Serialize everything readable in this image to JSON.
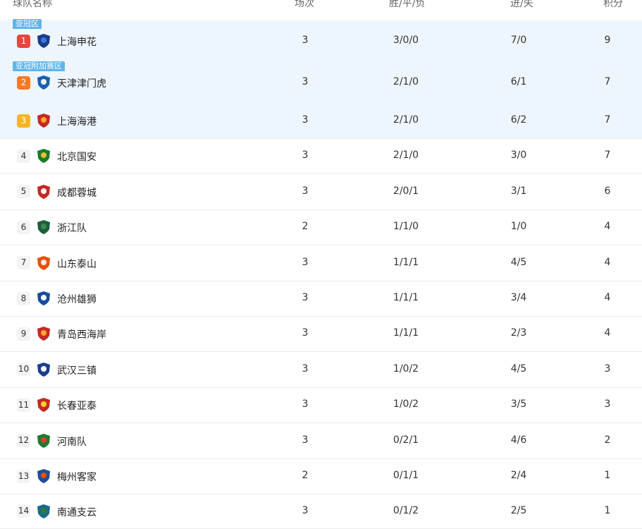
{
  "headers": {
    "team": "球队名称",
    "played": "场次",
    "wdl": "胜/平/负",
    "goals": "进/失",
    "points": "积分"
  },
  "zones": {
    "acl": "亚冠区",
    "acl_playoff": "亚冠附加赛区"
  },
  "rows": [
    {
      "rank": "1",
      "team": "上海申花",
      "played": "3",
      "wdl": "3/0/0",
      "goals": "7/0",
      "points": "9"
    },
    {
      "rank": "2",
      "team": "天津津门虎",
      "played": "3",
      "wdl": "2/1/0",
      "goals": "6/1",
      "points": "7"
    },
    {
      "rank": "3",
      "team": "上海海港",
      "played": "3",
      "wdl": "2/1/0",
      "goals": "6/2",
      "points": "7"
    },
    {
      "rank": "4",
      "team": "北京国安",
      "played": "3",
      "wdl": "2/1/0",
      "goals": "3/0",
      "points": "7"
    },
    {
      "rank": "5",
      "team": "成都蓉城",
      "played": "3",
      "wdl": "2/0/1",
      "goals": "3/1",
      "points": "6"
    },
    {
      "rank": "6",
      "team": "浙江队",
      "played": "2",
      "wdl": "1/1/0",
      "goals": "1/0",
      "points": "4"
    },
    {
      "rank": "7",
      "team": "山东泰山",
      "played": "3",
      "wdl": "1/1/1",
      "goals": "4/5",
      "points": "4"
    },
    {
      "rank": "8",
      "team": "沧州雄狮",
      "played": "3",
      "wdl": "1/1/1",
      "goals": "3/4",
      "points": "4"
    },
    {
      "rank": "9",
      "team": "青岛西海岸",
      "played": "3",
      "wdl": "1/1/1",
      "goals": "2/3",
      "points": "4"
    },
    {
      "rank": "10",
      "team": "武汉三镇",
      "played": "3",
      "wdl": "1/0/2",
      "goals": "4/5",
      "points": "3"
    },
    {
      "rank": "11",
      "team": "长春亚泰",
      "played": "3",
      "wdl": "1/0/2",
      "goals": "3/5",
      "points": "3"
    },
    {
      "rank": "12",
      "team": "河南队",
      "played": "3",
      "wdl": "0/2/1",
      "goals": "4/6",
      "points": "2"
    },
    {
      "rank": "13",
      "team": "梅州客家",
      "played": "2",
      "wdl": "0/1/1",
      "goals": "2/4",
      "points": "1"
    },
    {
      "rank": "14",
      "team": "南通支云",
      "played": "3",
      "wdl": "0/1/2",
      "goals": "2/5",
      "points": "1"
    }
  ],
  "colors": {
    "zone_label": "#5fb5ea",
    "highlight_row": "#eef6fd",
    "rank1": "#e8453c",
    "rank2": "#f57a28",
    "rank3": "#f6b526"
  },
  "logos": [
    "shenhua-crest-icon",
    "jinmenhu-crest-icon",
    "haigang-crest-icon",
    "guoan-crest-icon",
    "rongcheng-crest-icon",
    "zhejiang-crest-icon",
    "taishan-crest-icon",
    "xiongshi-crest-icon",
    "xihaian-crest-icon",
    "sanzhen-crest-icon",
    "yatai-crest-icon",
    "henan-crest-icon",
    "kejia-crest-icon",
    "zhiyun-crest-icon"
  ]
}
